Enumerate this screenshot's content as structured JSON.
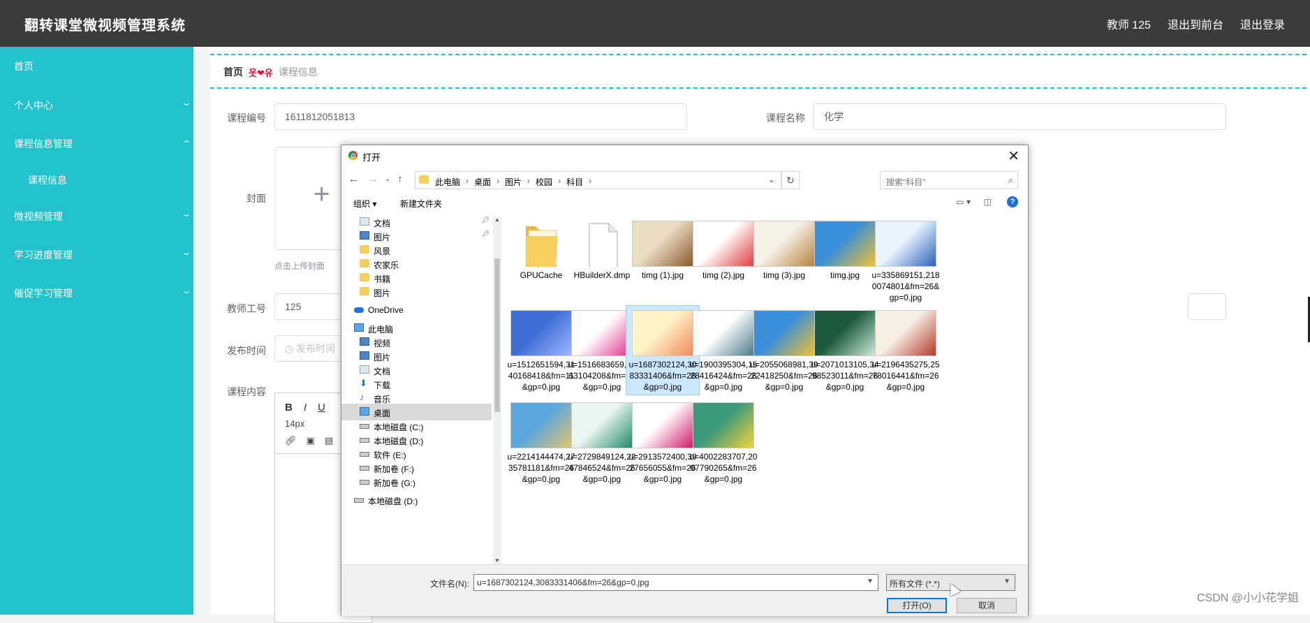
{
  "header": {
    "title": "翻转课堂微视频管理系统",
    "user": "教师 125",
    "to_front": "退出到前台",
    "logout": "退出登录"
  },
  "sidebar": {
    "items": [
      {
        "label": "首页"
      },
      {
        "label": "个人中心"
      },
      {
        "label": "课程信息管理"
      },
      {
        "label": "课程信息"
      },
      {
        "label": "微视频管理"
      },
      {
        "label": "学习进度管理"
      },
      {
        "label": "催促学习管理"
      }
    ]
  },
  "breadcrumb": {
    "home": "首页",
    "sep": "옷❤유",
    "current": "课程信息"
  },
  "form": {
    "course_no_label": "课程编号",
    "course_no_value": "1611812051813",
    "course_name_label": "课程名称",
    "course_name_value": "化学",
    "cover_label": "封面",
    "upload_tip": "点击上传封面",
    "teacher_no_label": "教师工号",
    "teacher_no_value": "125",
    "publish_time_label": "发布时间",
    "publish_time_placeholder": "发布时间",
    "content_label": "课程内容",
    "editor": {
      "bold": "B",
      "italic": "I",
      "underline": "U",
      "font_size": "14px"
    }
  },
  "dialog": {
    "title": "打开",
    "path": [
      "此电脑",
      "桌面",
      "图片",
      "校园",
      "科目"
    ],
    "search_placeholder": "搜索\"科目\"",
    "organize": "组织 ▾",
    "new_folder": "新建文件夹",
    "tree": [
      {
        "label": "文档",
        "type": "doc",
        "pinned": true
      },
      {
        "label": "图片",
        "type": "img",
        "pinned": true
      },
      {
        "label": "风景",
        "type": "folder"
      },
      {
        "label": "农家乐",
        "type": "folder"
      },
      {
        "label": "书籍",
        "type": "folder"
      },
      {
        "label": "图片",
        "type": "folder"
      },
      {
        "label": "OneDrive",
        "type": "cloud"
      },
      {
        "label": "此电脑",
        "type": "pc"
      },
      {
        "label": "视频",
        "type": "img"
      },
      {
        "label": "图片",
        "type": "img"
      },
      {
        "label": "文档",
        "type": "doc"
      },
      {
        "label": "下载",
        "type": "dl"
      },
      {
        "label": "音乐",
        "type": "music"
      },
      {
        "label": "桌面",
        "type": "pc",
        "selected": true
      },
      {
        "label": "本地磁盘 (C:)",
        "type": "drive"
      },
      {
        "label": "本地磁盘 (D:)",
        "type": "drive"
      },
      {
        "label": "软件 (E:)",
        "type": "drive"
      },
      {
        "label": "新加卷 (F:)",
        "type": "drive"
      },
      {
        "label": "新加卷 (G:)",
        "type": "drive"
      },
      {
        "label": "本地磁盘 (D:)",
        "type": "drive"
      }
    ],
    "files": [
      {
        "name": "GPUCache",
        "kind": "folder"
      },
      {
        "name": "HBuilderX.dmp",
        "kind": "doc"
      },
      {
        "name": "timg (1).jpg",
        "kind": "img",
        "colors": [
          "#e8dcc2",
          "#8a5a2b"
        ]
      },
      {
        "name": "timg (2).jpg",
        "kind": "img",
        "colors": [
          "#ffffff",
          "#e23b3b"
        ]
      },
      {
        "name": "timg (3).jpg",
        "kind": "img",
        "colors": [
          "#f7f2e8",
          "#b6823d"
        ]
      },
      {
        "name": "timg.jpg",
        "kind": "img",
        "colors": [
          "#3a8fd8",
          "#f2c230"
        ]
      },
      {
        "name": "u=335869151,2180074801&fm=26&gp=0.jpg",
        "kind": "img",
        "colors": [
          "#eaf4ff",
          "#2b62b8"
        ]
      },
      {
        "name": "u=1512651594,3140168418&fm=11&gp=0.jpg",
        "kind": "img",
        "colors": [
          "#3f6fd4",
          "#9fb6ff"
        ]
      },
      {
        "name": "u=1516683659,2163104208&fm=26&gp=0.jpg",
        "kind": "img",
        "colors": [
          "#ffffff",
          "#e02d8b"
        ]
      },
      {
        "name": "u=1687302124,3083331406&fm=26&gp=0.jpg",
        "kind": "img",
        "colors": [
          "#fff3c8",
          "#f08a5d"
        ],
        "selected": true
      },
      {
        "name": "u=1900395304,1528416424&fm=26&gp=0.jpg",
        "kind": "img",
        "colors": [
          "#ffffff",
          "#4a7a8c"
        ]
      },
      {
        "name": "u=2055068981,3922418250&fm=26&gp=0.jpg",
        "kind": "img",
        "colors": [
          "#3a8fd8",
          "#f2c230"
        ]
      },
      {
        "name": "u=2071013105,3498523011&fm=26&gp=0.jpg",
        "kind": "img",
        "colors": [
          "#1d5b3c",
          "#cfe9d8"
        ]
      },
      {
        "name": "u=2196435275,2578016441&fm=26&gp=0.jpg",
        "kind": "img",
        "colors": [
          "#f7efe3",
          "#b23a2a"
        ]
      },
      {
        "name": "u=2214144474,2735781181&fm=26&gp=0.jpg",
        "kind": "img",
        "colors": [
          "#5aa7e0",
          "#e3c46b"
        ]
      },
      {
        "name": "u=2729849124,2247846524&fm=26&gp=0.jpg",
        "kind": "img",
        "colors": [
          "#e9f6f0",
          "#1e8a6b"
        ]
      },
      {
        "name": "u=2913572400,3927656055&fm=26&gp=0.jpg",
        "kind": "img",
        "colors": [
          "#ffffff",
          "#d21b6e"
        ]
      },
      {
        "name": "u=4002283707,2007790265&fm=26&gp=0.jpg",
        "kind": "img",
        "colors": [
          "#3c9a7c",
          "#f4d23a"
        ]
      }
    ],
    "filename_label": "文件名(N):",
    "filename_value": "u=1687302124,3083331406&fm=26&gp=0.jpg",
    "filter_value": "所有文件 (*.*)",
    "open_button": "打开(O)",
    "cancel_button": "取消"
  },
  "watermark": "CSDN @小小花学姐",
  "colors": {
    "sidebar": "#21c2cb",
    "header": "#3b3b3b",
    "accent_dash": "#21c2cb"
  }
}
